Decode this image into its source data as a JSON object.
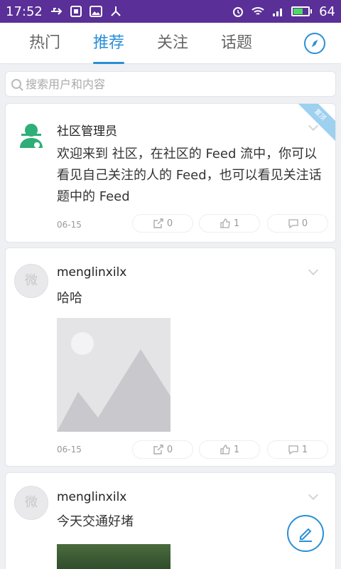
{
  "statusbar": {
    "time": "17:52",
    "battery": "64",
    "icons": [
      "usb-icon",
      "notification-icon",
      "image-icon",
      "share-icon",
      "alarm-icon",
      "wifi-icon",
      "signal-icon",
      "battery-icon"
    ]
  },
  "tabs": [
    {
      "label": "热门"
    },
    {
      "label": "推荐"
    },
    {
      "label": "关注"
    },
    {
      "label": "话题"
    }
  ],
  "active_tab": "推荐",
  "search": {
    "placeholder": "搜索用户和内容"
  },
  "posts": [
    {
      "username": "社区管理员",
      "content": "欢迎来到 社区，在社区的 Feed 流中，你可以看见自己关注的人的 Feed，也可以看见关注话题中的 Feed",
      "date": "06-15",
      "shares": "0",
      "likes": "1",
      "comments": "0",
      "badge": "置顶"
    },
    {
      "username": "menglinxilx",
      "content": "哈哈",
      "date": "06-15",
      "shares": "0",
      "likes": "1",
      "comments": "1",
      "avatar_char": "微"
    },
    {
      "username": "menglinxilx",
      "content": "今天交通好堵",
      "avatar_char": "微"
    }
  ],
  "colors": {
    "accent": "#2a8fd6",
    "statusbar": "#5a2f97",
    "admin_avatar": "#2fae78"
  }
}
